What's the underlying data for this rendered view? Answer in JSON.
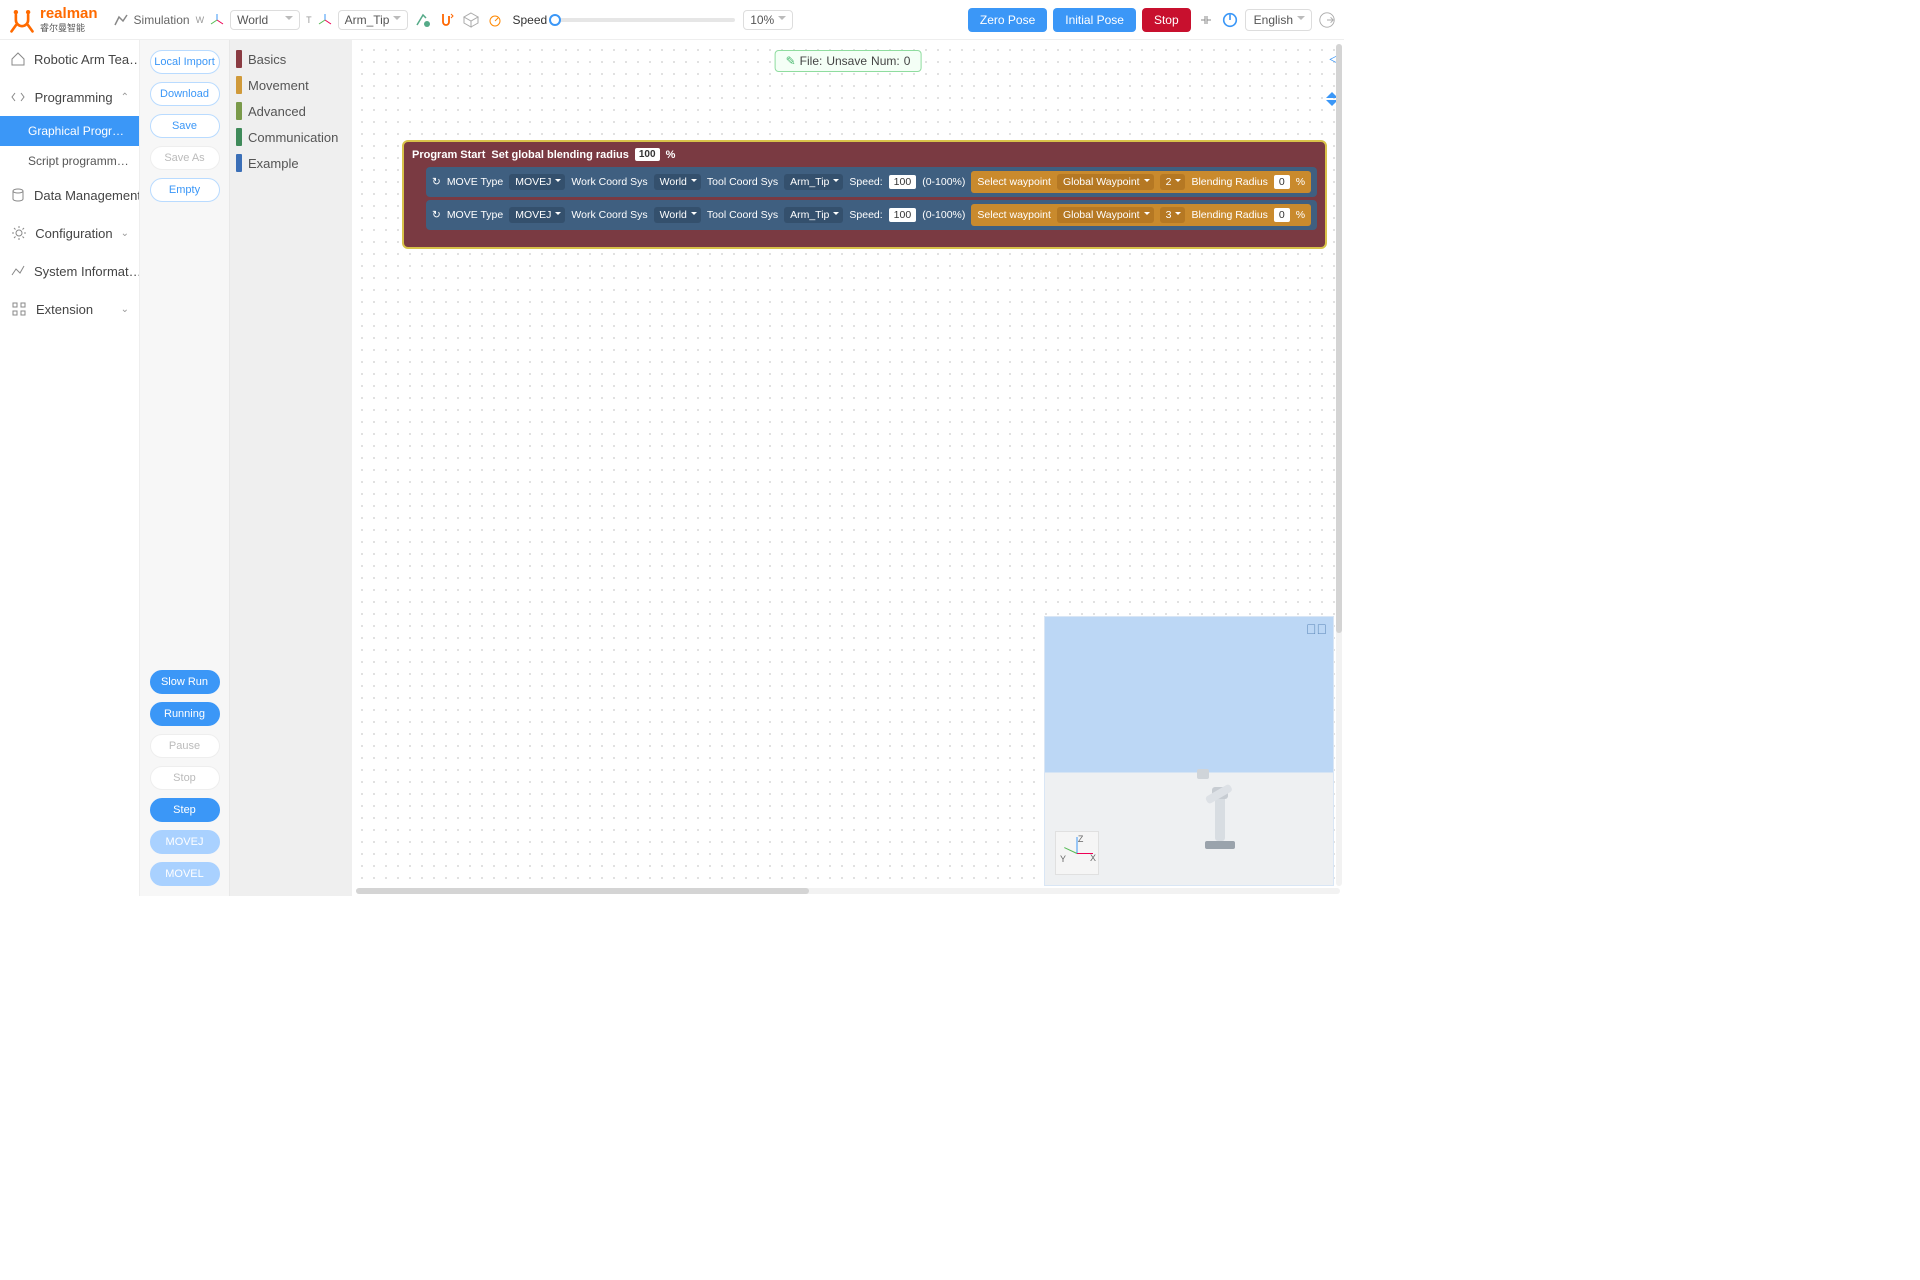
{
  "brand": {
    "name": "realman",
    "sub": "睿尔曼智能"
  },
  "topbar": {
    "simulation_label": "Simulation",
    "world_label_prefix": "W",
    "world_value": "World",
    "tool_label_prefix": "T",
    "tool_value": "Arm_Tip",
    "speed_label": "Speed",
    "speed_percent": "10%",
    "zero_pose": "Zero Pose",
    "initial_pose": "Initial Pose",
    "stop": "Stop",
    "language": "English"
  },
  "nav": {
    "items": [
      {
        "label": "Robotic Arm Tea…",
        "icon": "home"
      },
      {
        "label": "Programming",
        "icon": "code",
        "expanded": true,
        "children": [
          {
            "label": "Graphical Progr…",
            "active": true
          },
          {
            "label": "Script programm…"
          }
        ]
      },
      {
        "label": "Data Management",
        "icon": "db"
      },
      {
        "label": "Configuration",
        "icon": "gear",
        "chev": true
      },
      {
        "label": "System Informat…",
        "icon": "chart"
      },
      {
        "label": "Extension",
        "icon": "grid",
        "chev": true
      }
    ]
  },
  "file_buttons": {
    "local_import": "Local Import",
    "download": "Download",
    "save": "Save",
    "save_as": "Save As",
    "empty": "Empty"
  },
  "run_buttons": {
    "slow_run": "Slow Run",
    "running": "Running",
    "pause": "Pause",
    "stop": "Stop",
    "step": "Step",
    "movej": "MOVEJ",
    "movel": "MOVEL"
  },
  "categories": [
    {
      "label": "Basics",
      "color": "#8a3b42"
    },
    {
      "label": "Movement",
      "color": "#d09a3a"
    },
    {
      "label": "Advanced",
      "color": "#7a9a4a"
    },
    {
      "label": "Communication",
      "color": "#3f8a5a"
    },
    {
      "label": "Example",
      "color": "#3b6fb7"
    }
  ],
  "file_status": {
    "prefix": "File:",
    "name": "Unsave",
    "num_label": "Num:",
    "num": "0"
  },
  "program": {
    "head_a": "Program Start",
    "head_b": "Set global blending radius",
    "head_val": "100",
    "head_unit": "%",
    "moves": [
      {
        "move_type_lbl": "MOVE Type",
        "move_type": "MOVEJ",
        "work_lbl": "Work Coord Sys",
        "work": "World",
        "tool_lbl": "Tool Coord Sys",
        "tool": "Arm_Tip",
        "speed_lbl": "Speed:",
        "speed_val": "100",
        "speed_range": "(0-100%)",
        "sel_lbl": "Select waypoint",
        "gw": "Global Waypoint",
        "idx": "2",
        "br_lbl": "Blending Radius",
        "br_val": "0",
        "br_unit": "%"
      },
      {
        "move_type_lbl": "MOVE Type",
        "move_type": "MOVEJ",
        "work_lbl": "Work Coord Sys",
        "work": "World",
        "tool_lbl": "Tool Coord Sys",
        "tool": "Arm_Tip",
        "speed_lbl": "Speed:",
        "speed_val": "100",
        "speed_range": "(0-100%)",
        "sel_lbl": "Select waypoint",
        "gw": "Global Waypoint",
        "idx": "3",
        "br_lbl": "Blending Radius",
        "br_val": "0",
        "br_unit": "%"
      }
    ]
  },
  "axes": {
    "z": "Z",
    "y": "Y",
    "x": "X"
  }
}
